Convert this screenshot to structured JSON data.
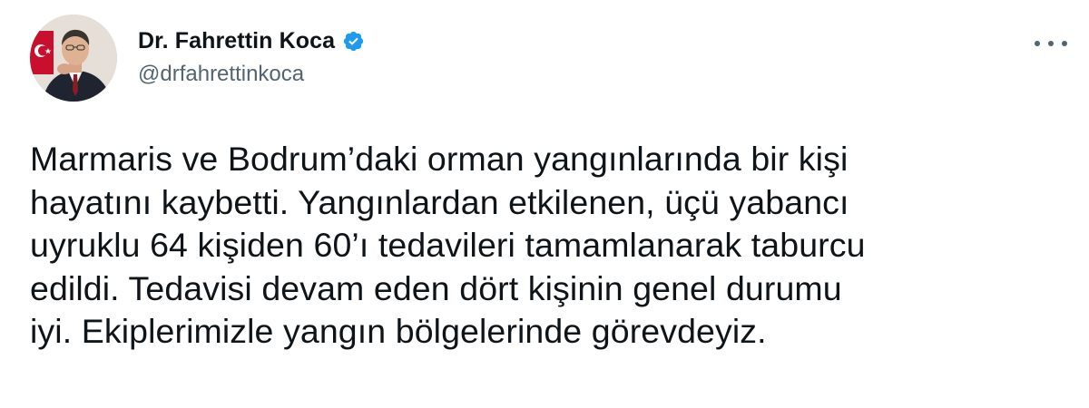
{
  "author": {
    "display_name": "Dr. Fahrettin Koca",
    "handle": "@drfahrettinkoca",
    "verified": true
  },
  "icons": {
    "verified": "verified-badge-icon",
    "more": "more-options-icon"
  },
  "colors": {
    "verified": "#1d9bf0",
    "text": "#0f1419",
    "secondary": "#536471"
  },
  "tweet": {
    "text": "Marmaris ve Bodrum’daki orman yangınlarında bir kişi\nhayatını kaybetti. Yangınlardan etkilenen, üçü yabancı\nuyruklu 64 kişiden 60’ı tedavileri tamamlanarak taburcu\nedildi. Tedavisi devam eden dört kişinin genel durumu\niyi. Ekiplerimizle yangın bölgelerinde görevdeyiz."
  }
}
